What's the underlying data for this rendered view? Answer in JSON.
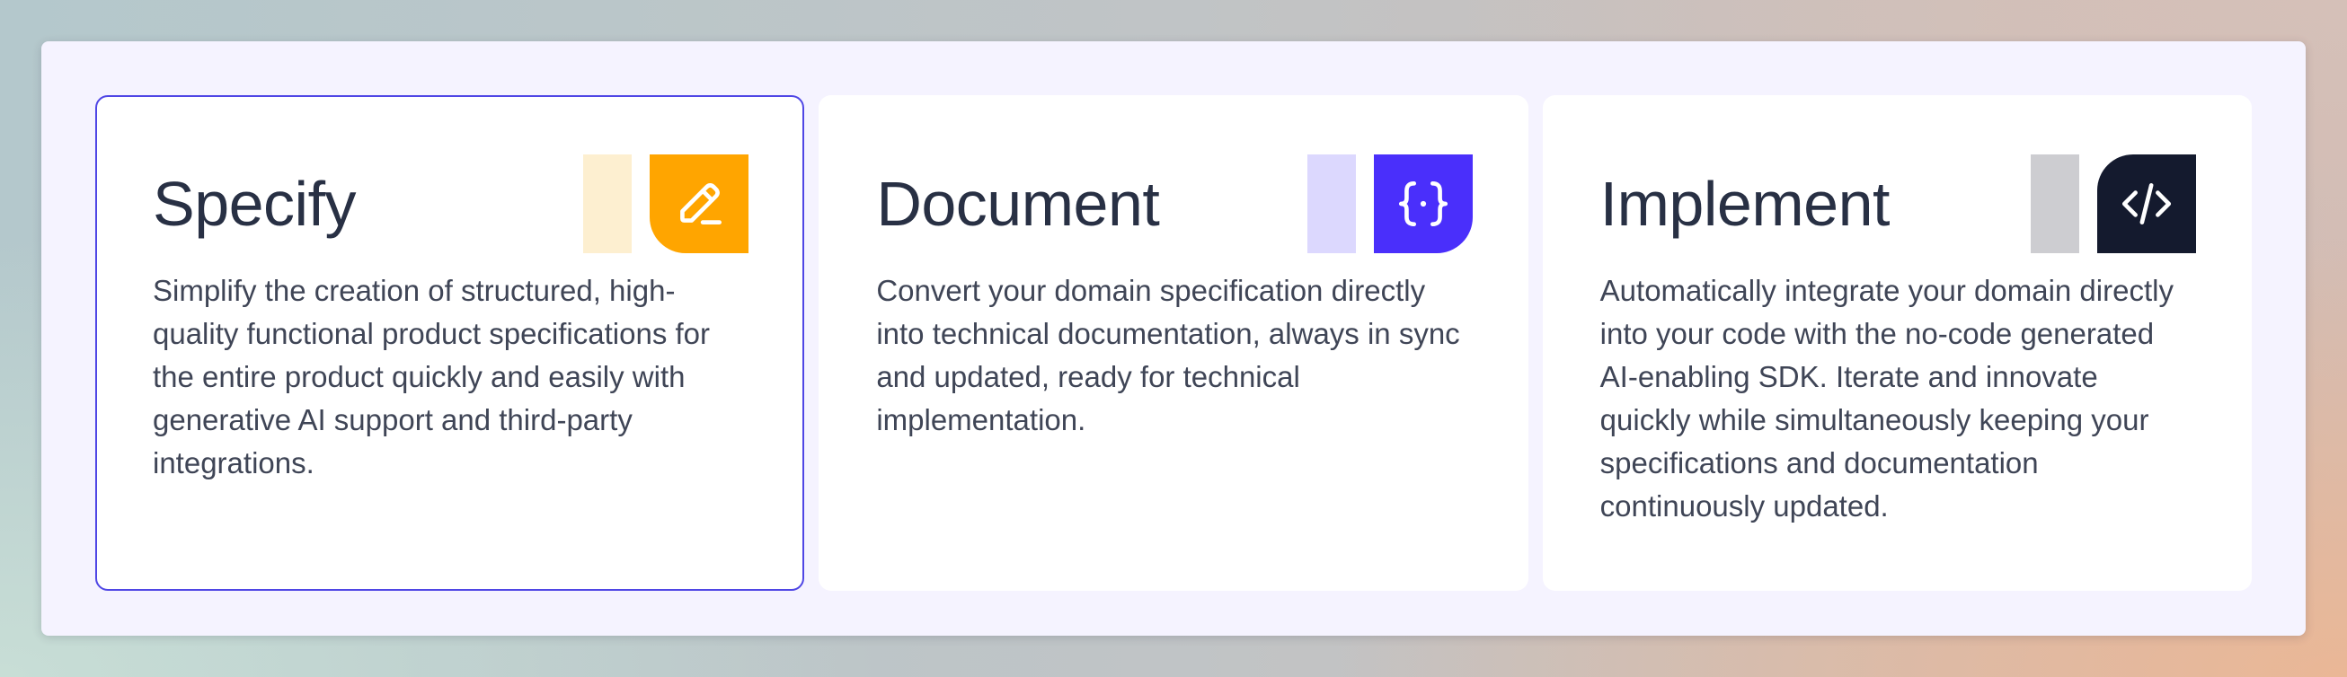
{
  "cards": [
    {
      "title": "Specify",
      "description": "Simplify the creation of structured, high-quality functional product specifications for the entire product quickly and easily with generative AI support and third-party integrations.",
      "icon": "pencil-icon",
      "strip_color": "#fdefd0",
      "tile_color": "#ffa500",
      "active": true
    },
    {
      "title": "Document",
      "description": "Convert your domain specification directly into technical documentation, always in sync and updated, ready for technical implementation.",
      "icon": "curly-braces-icon",
      "strip_color": "#dcd8fe",
      "tile_color": "#4a2ffb",
      "active": false
    },
    {
      "title": "Implement",
      "description": "Automatically integrate your domain directly into your code with the no-code generated AI-enabling SDK. Iterate and innovate quickly while simultaneously keeping your specifications and documentation continuously updated.",
      "icon": "code-icon",
      "strip_color": "#cdcdd1",
      "tile_color": "#141a2e",
      "active": false
    }
  ],
  "colors": {
    "active_border": "#4f46e5",
    "title_text": "#283044",
    "body_text": "#3f4556",
    "panel_bg": "#f5f3ff"
  }
}
